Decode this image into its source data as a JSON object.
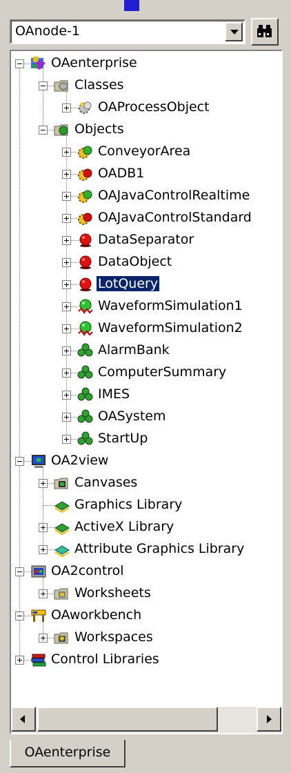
{
  "node_select": {
    "value": "OAnode-1"
  },
  "tab": {
    "label": "OAenterprise"
  },
  "tree": [
    {
      "label": "OAenterprise",
      "level": 0,
      "exp": "minus",
      "icon": "enterprise"
    },
    {
      "label": "Classes",
      "level": 1,
      "exp": "minus",
      "icon": "folder-gray"
    },
    {
      "label": "OAProcessObject",
      "level": 2,
      "exp": "plus",
      "icon": "gear-gray"
    },
    {
      "label": "Objects",
      "level": 1,
      "exp": "minus",
      "icon": "folder-green"
    },
    {
      "label": "ConveyorArea",
      "level": 2,
      "exp": "plus",
      "icon": "gear-green"
    },
    {
      "label": "OADB1",
      "level": 2,
      "exp": "plus",
      "icon": "gear-red"
    },
    {
      "label": "OAJavaControlRealtime",
      "level": 2,
      "exp": "plus",
      "icon": "gear-green"
    },
    {
      "label": "OAJavaControlStandard",
      "level": 2,
      "exp": "plus",
      "icon": "gear-red"
    },
    {
      "label": "DataSeparator",
      "level": 2,
      "exp": "plus",
      "icon": "ball-red"
    },
    {
      "label": "DataObject",
      "level": 2,
      "exp": "plus",
      "icon": "ball-red"
    },
    {
      "label": "LotQuery",
      "level": 2,
      "exp": "plus",
      "icon": "ball-red",
      "selected": true
    },
    {
      "label": "WaveformSimulation1",
      "level": 2,
      "exp": "plus",
      "icon": "ball-green-wave"
    },
    {
      "label": "WaveformSimulation2",
      "level": 2,
      "exp": "plus",
      "icon": "ball-green-wave"
    },
    {
      "label": "AlarmBank",
      "level": 2,
      "exp": "plus",
      "icon": "cluster-green"
    },
    {
      "label": "ComputerSummary",
      "level": 2,
      "exp": "plus",
      "icon": "cluster-green"
    },
    {
      "label": "IMES",
      "level": 2,
      "exp": "plus",
      "icon": "cluster-green"
    },
    {
      "label": "OASystem",
      "level": 2,
      "exp": "plus",
      "icon": "cluster-green"
    },
    {
      "label": "StartUp",
      "level": 2,
      "exp": "plus",
      "icon": "cluster-green"
    },
    {
      "label": "OA2view",
      "level": 0,
      "exp": "minus",
      "icon": "monitor"
    },
    {
      "label": "Canvases",
      "level": 1,
      "exp": "plus",
      "icon": "canvas"
    },
    {
      "label": "Graphics Library",
      "level": 1,
      "exp": "none",
      "icon": "book-green"
    },
    {
      "label": "ActiveX Library",
      "level": 1,
      "exp": "plus",
      "icon": "book-green"
    },
    {
      "label": "Attribute Graphics Library",
      "level": 1,
      "exp": "plus",
      "icon": "book-teal"
    },
    {
      "label": "OA2control",
      "level": 0,
      "exp": "minus",
      "icon": "control"
    },
    {
      "label": "Worksheets",
      "level": 1,
      "exp": "plus",
      "icon": "worksheet"
    },
    {
      "label": "OAworkbench",
      "level": 0,
      "exp": "minus",
      "icon": "bench"
    },
    {
      "label": "Workspaces",
      "level": 1,
      "exp": "plus",
      "icon": "workspace"
    },
    {
      "label": "Control Libraries",
      "level": 0,
      "exp": "plus",
      "icon": "books"
    }
  ]
}
